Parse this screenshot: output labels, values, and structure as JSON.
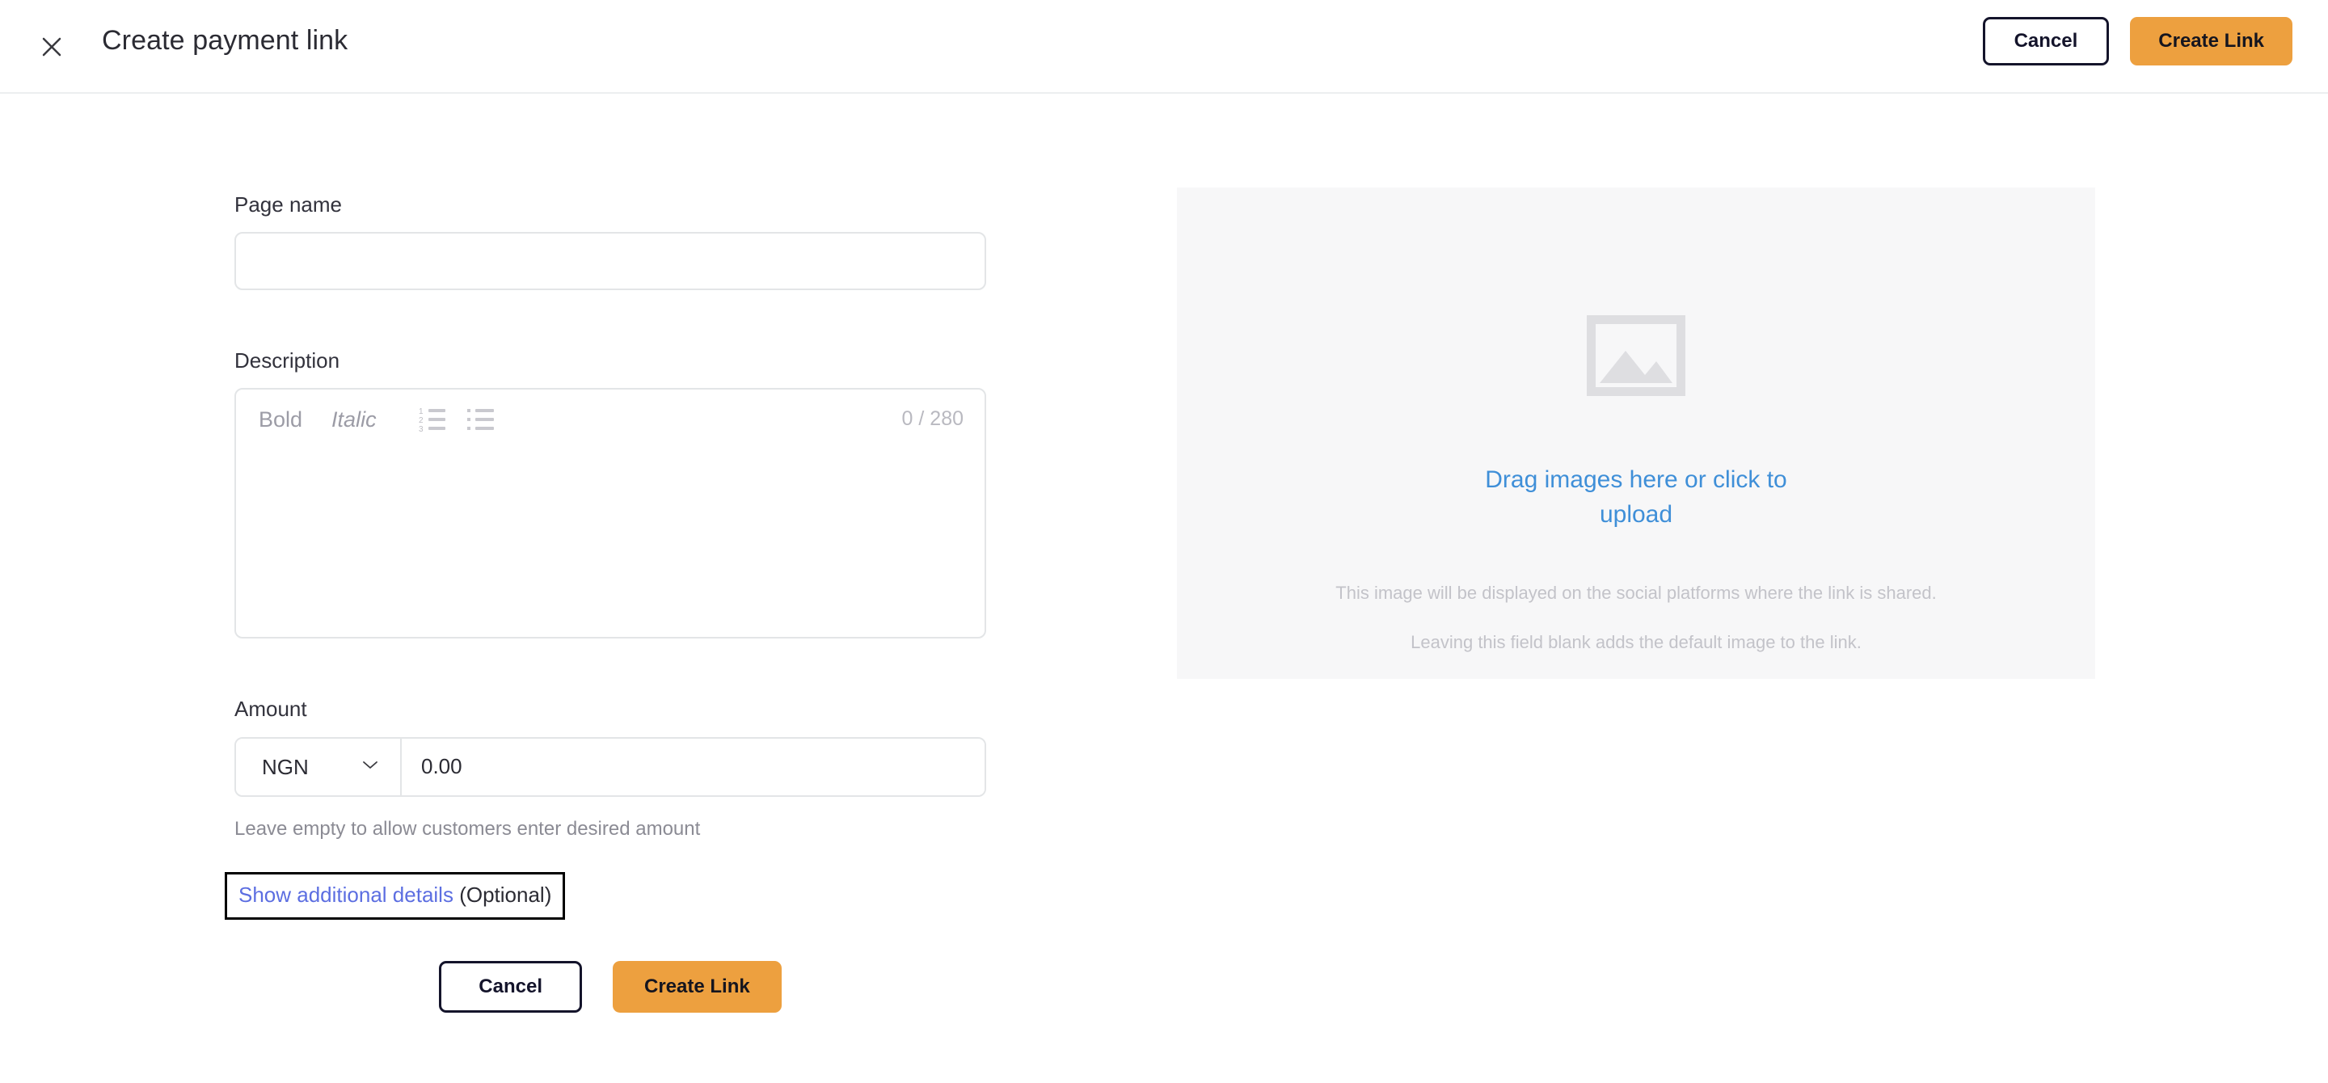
{
  "header": {
    "close_icon": "close-icon",
    "title": "Create payment link",
    "cancel_label": "Cancel",
    "create_label": "Create Link"
  },
  "form": {
    "page_name": {
      "label": "Page name",
      "value": "",
      "placeholder": ""
    },
    "description": {
      "label": "Description",
      "toolbar": {
        "bold_label": "Bold",
        "italic_label": "Italic",
        "ordered_list_icon": "ordered-list-icon",
        "bullet_list_icon": "bullet-list-icon"
      },
      "char_count": "0 / 280",
      "value": "",
      "max_chars": 280
    },
    "amount": {
      "label": "Amount",
      "currency": "NGN",
      "currency_chevron_icon": "chevron-down-icon",
      "value": "0.00",
      "placeholder": "0.00",
      "help_text": "Leave empty to allow customers enter desired amount"
    },
    "additional_details": {
      "link_label": "Show additional details",
      "optional_label": "(Optional)"
    }
  },
  "footer": {
    "cancel_label": "Cancel",
    "create_label": "Create Link"
  },
  "upload": {
    "placeholder_icon": "image-placeholder-icon",
    "cta_text": "Drag images here or click to upload",
    "note_1": "This image will be displayed on the social platforms where the link is shared.",
    "note_2": "Leaving this field blank adds the default image to the link."
  },
  "colors": {
    "accent_orange": "#EDA03F",
    "link_blue": "#3F8FD8",
    "link_purple": "#5C6EE1",
    "dark": "#14142B",
    "panel_gray": "#F7F7F8"
  }
}
